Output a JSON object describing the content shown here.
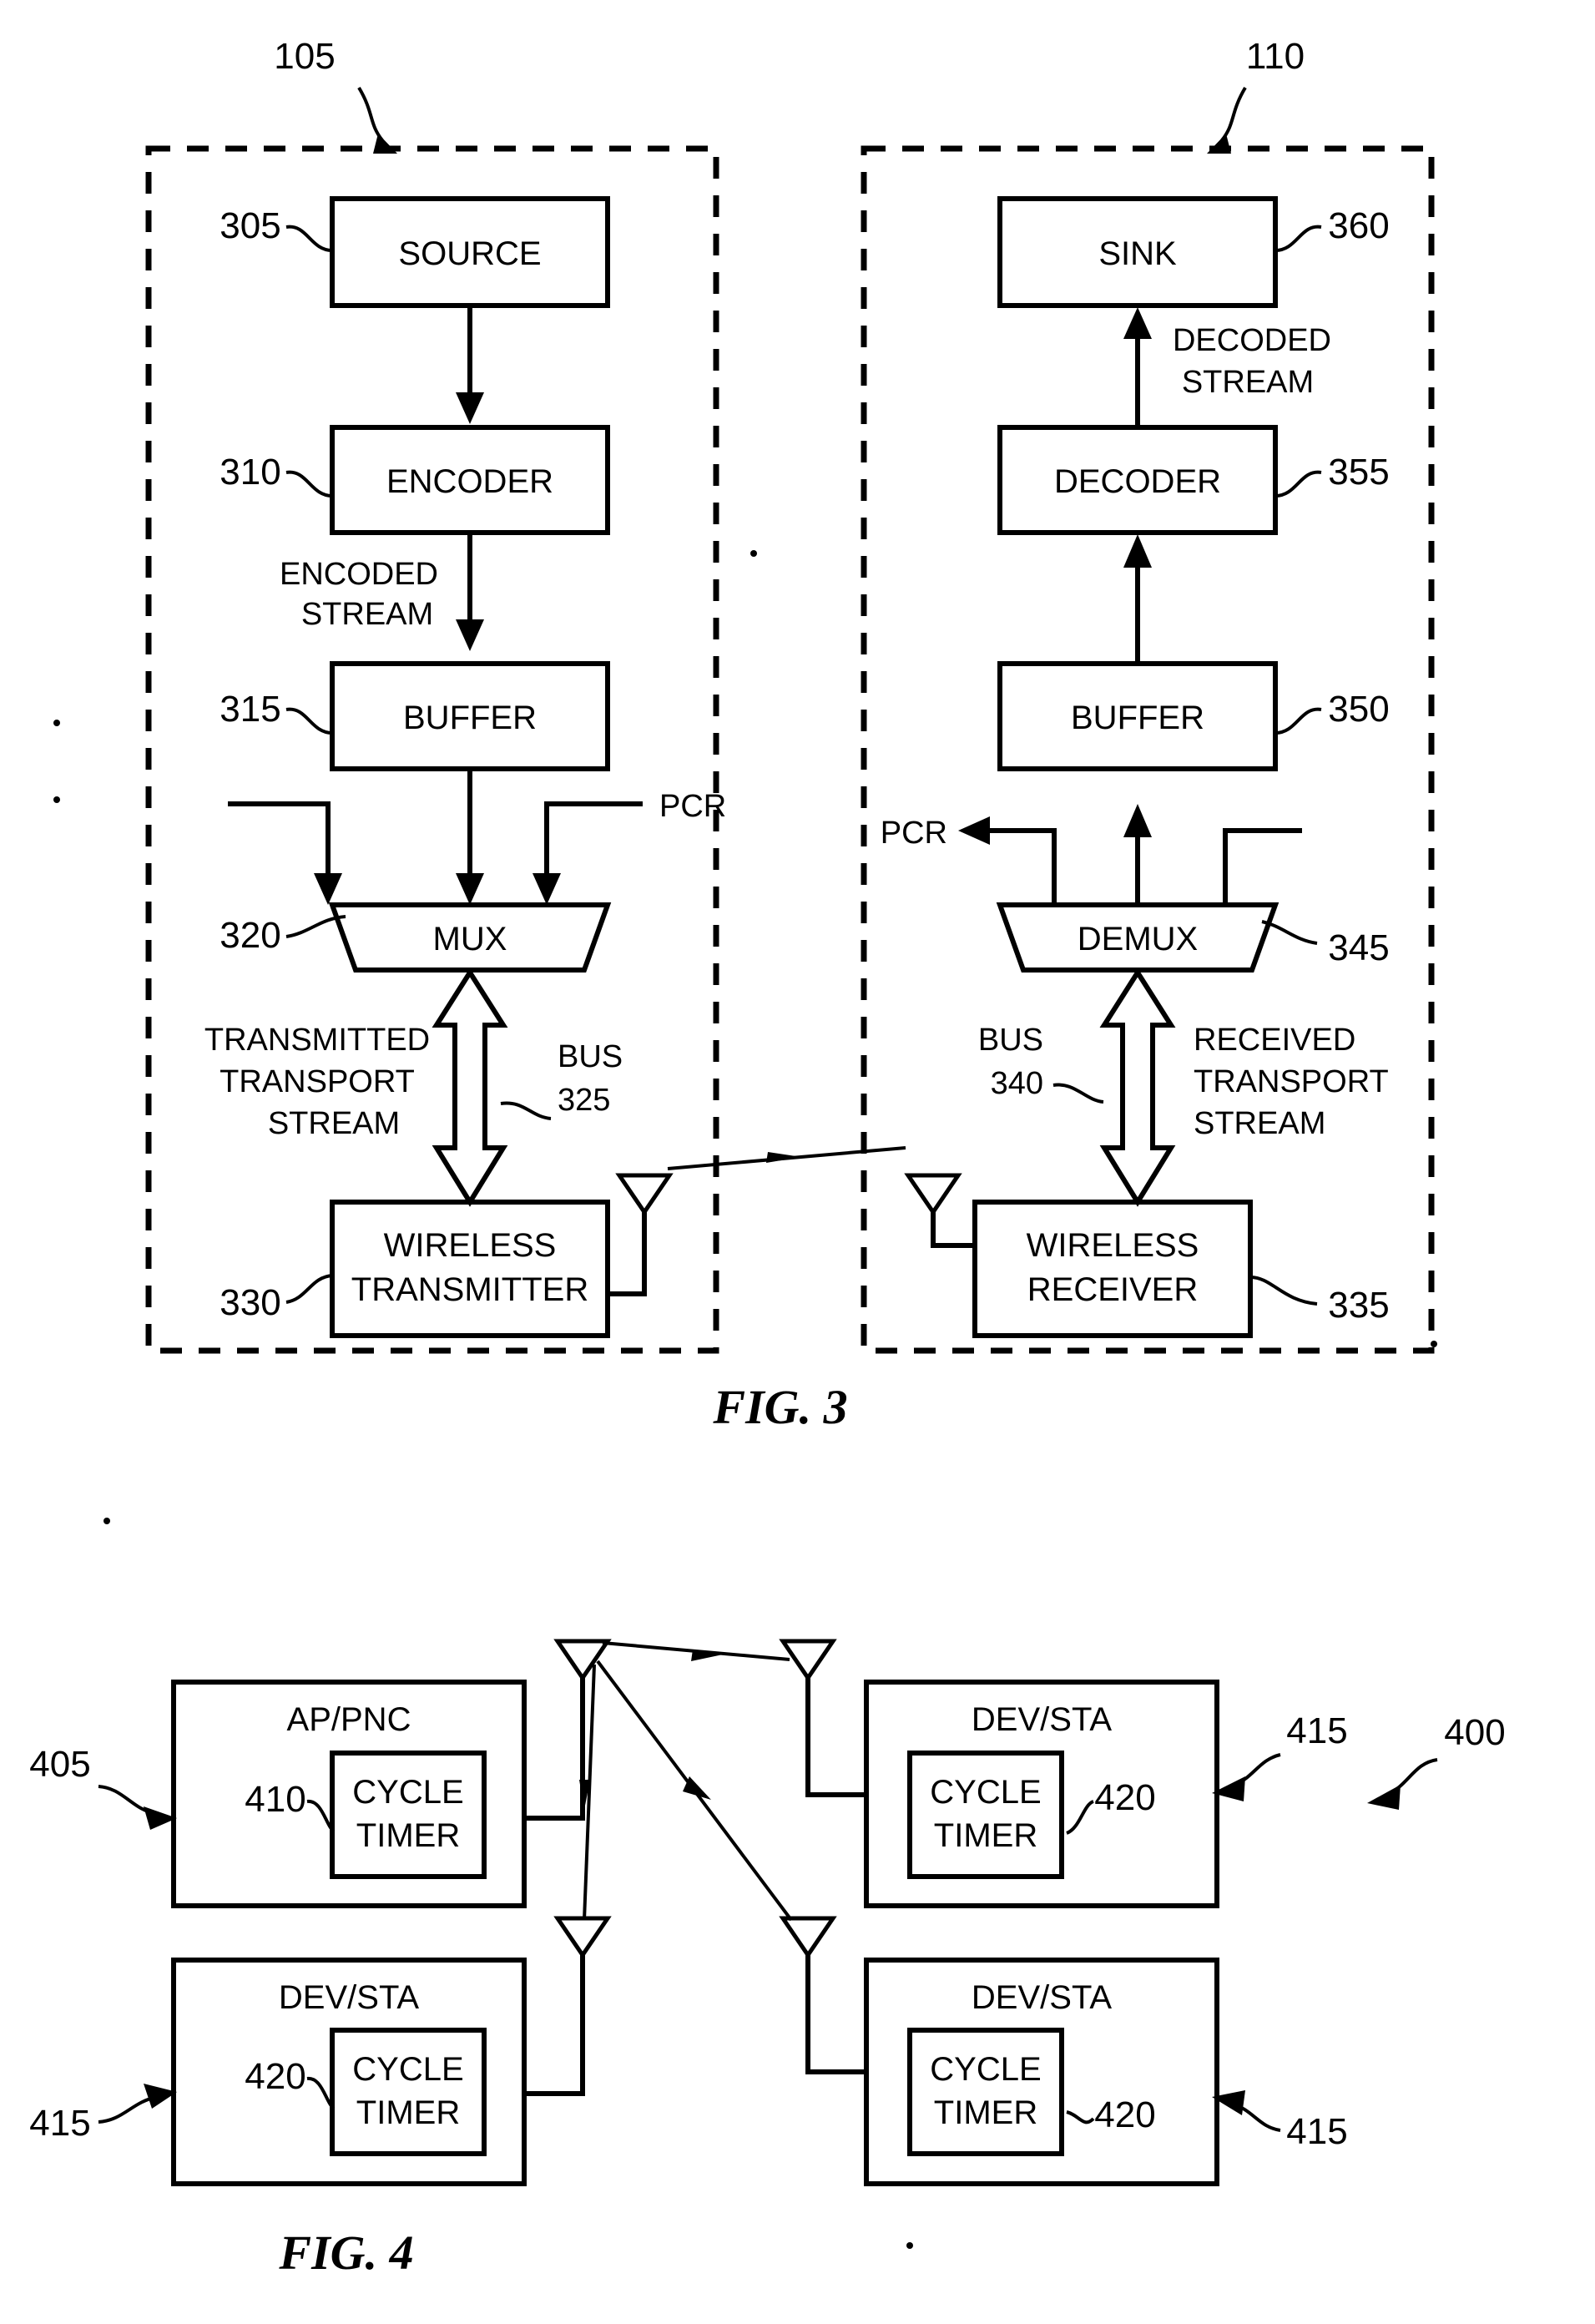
{
  "figure3": {
    "caption": "FIG. 3",
    "transmitter_group_ref": "105",
    "receiver_group_ref": "110",
    "transmit_chain": [
      {
        "ref": "305",
        "label": "SOURCE"
      },
      {
        "ref": "310",
        "label": "ENCODER"
      },
      {
        "ref": "315",
        "label": "BUFFER"
      },
      {
        "ref": "320",
        "label": "MUX"
      },
      {
        "ref": "330",
        "label_line1": "WIRELESS",
        "label_line2": "TRANSMITTER"
      }
    ],
    "receive_chain": [
      {
        "ref": "360",
        "label": "SINK"
      },
      {
        "ref": "355",
        "label": "DECODER"
      },
      {
        "ref": "350",
        "label": "BUFFER"
      },
      {
        "ref": "345",
        "label": "DEMUX"
      },
      {
        "ref": "335",
        "label_line1": "WIRELESS",
        "label_line2": "RECEIVER"
      }
    ],
    "edge_labels": {
      "encoded_stream_line1": "ENCODED",
      "encoded_stream_line2": "STREAM",
      "decoded_stream_line1": "DECODED",
      "decoded_stream_line2": "STREAM",
      "pcr_tx": "PCR",
      "pcr_rx": "PCR",
      "transmitted_line1": "TRANSMITTED",
      "transmitted_line2": "TRANSPORT",
      "transmitted_line3": "STREAM",
      "received_line1": "RECEIVED",
      "received_line2": "TRANSPORT",
      "received_line3": "STREAM",
      "bus_tx_word": "BUS",
      "bus_tx_ref": "325",
      "bus_rx_word": "BUS",
      "bus_rx_ref": "340"
    }
  },
  "figure4": {
    "caption": "FIG. 4",
    "system_ref": "400",
    "nodes": [
      {
        "ref": "405",
        "title": "AP/PNC",
        "inner_ref": "410",
        "inner_line1": "CYCLE",
        "inner_line2": "TIMER"
      },
      {
        "ref": "415",
        "title": "DEV/STA",
        "inner_ref": "420",
        "inner_line1": "CYCLE",
        "inner_line2": "TIMER"
      },
      {
        "ref": "415",
        "title": "DEV/STA",
        "inner_ref": "420",
        "inner_line1": "CYCLE",
        "inner_line2": "TIMER"
      },
      {
        "ref": "415",
        "title": "DEV/STA",
        "inner_ref": "420",
        "inner_line1": "CYCLE",
        "inner_line2": "TIMER"
      }
    ]
  }
}
